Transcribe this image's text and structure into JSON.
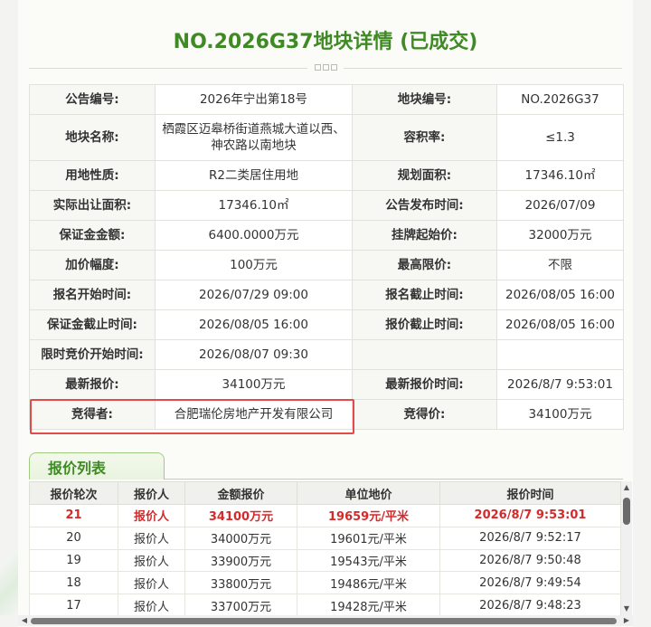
{
  "page_title": "NO.2026G37地块详情 (已成交)",
  "info_rows": [
    [
      {
        "label": "公告编号:",
        "value": "2026年宁出第18号"
      },
      {
        "label": "地块编号:",
        "value": "NO.2026G37"
      }
    ],
    [
      {
        "label": "地块名称:",
        "value": "栖霞区迈皋桥街道燕城大道以西、神农路以南地块"
      },
      {
        "label": "容积率:",
        "value": "≤1.3"
      }
    ],
    [
      {
        "label": "用地性质:",
        "value": "R2二类居住用地"
      },
      {
        "label": "规划面积:",
        "value": "17346.10㎡"
      }
    ],
    [
      {
        "label": "实际出让面积:",
        "value": "17346.10㎡"
      },
      {
        "label": "公告发布时间:",
        "value": "2026/07/09"
      }
    ],
    [
      {
        "label": "保证金金额:",
        "value": "6400.0000万元"
      },
      {
        "label": "挂牌起始价:",
        "value": "32000万元"
      }
    ],
    [
      {
        "label": "加价幅度:",
        "value": "100万元"
      },
      {
        "label": "最高限价:",
        "value": "不限"
      }
    ],
    [
      {
        "label": "报名开始时间:",
        "value": "2026/07/29 09:00"
      },
      {
        "label": "报名截止时间:",
        "value": "2026/08/05 16:00"
      }
    ],
    [
      {
        "label": "保证金截止时间:",
        "value": "2026/08/05 16:00"
      },
      {
        "label": "报价截止时间:",
        "value": "2026/08/05 16:00"
      }
    ],
    [
      {
        "label": "限时竞价开始时间:",
        "value": "2026/08/07 09:30"
      },
      {
        "label": "",
        "value": ""
      }
    ],
    [
      {
        "label": "最新报价:",
        "value": "34100万元"
      },
      {
        "label": "最新报价时间:",
        "value": "2026/8/7 9:53:01"
      }
    ],
    [
      {
        "label": "竞得者:",
        "value": "合肥瑞伦房地产开发有限公司"
      },
      {
        "label": "竞得价:",
        "value": "34100万元"
      }
    ]
  ],
  "colors": {
    "accent_green": "#3f8a25",
    "price_green": "#2f9a32",
    "alert_red": "#e03030",
    "highlight_border": "#e24b4b"
  },
  "bid_tab_label": "报价列表",
  "bid_columns": [
    "报价轮次",
    "报价人",
    "金额报价",
    "单位地价",
    "报价时间"
  ],
  "bids": [
    [
      "21",
      "报价人",
      "34100万元",
      "19659元/平米",
      "2026/8/7 9:53:01"
    ],
    [
      "20",
      "报价人",
      "34000万元",
      "19601元/平米",
      "2026/8/7 9:52:17"
    ],
    [
      "19",
      "报价人",
      "33900万元",
      "19543元/平米",
      "2026/8/7 9:50:48"
    ],
    [
      "18",
      "报价人",
      "33800万元",
      "19486元/平米",
      "2026/8/7 9:49:54"
    ],
    [
      "17",
      "报价人",
      "33700万元",
      "19428元/平米",
      "2026/8/7 9:48:23"
    ]
  ]
}
